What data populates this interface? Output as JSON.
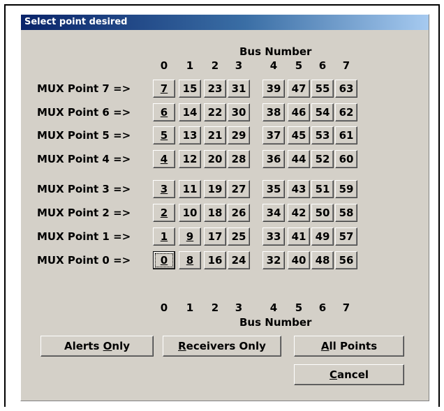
{
  "dialog": {
    "title": "Select point desired",
    "bus_number_label": "Bus Number",
    "bus_columns": [
      "0",
      "1",
      "2",
      "3",
      "4",
      "5",
      "6",
      "7"
    ],
    "rows": [
      {
        "label": "MUX Point 7 =>",
        "points": [
          "7",
          "15",
          "23",
          "31",
          "39",
          "47",
          "55",
          "63"
        ]
      },
      {
        "label": "MUX Point 6 =>",
        "points": [
          "6",
          "14",
          "22",
          "30",
          "38",
          "46",
          "54",
          "62"
        ]
      },
      {
        "label": "MUX Point 5 =>",
        "points": [
          "5",
          "13",
          "21",
          "29",
          "37",
          "45",
          "53",
          "61"
        ]
      },
      {
        "label": "MUX Point 4 =>",
        "points": [
          "4",
          "12",
          "20",
          "28",
          "36",
          "44",
          "52",
          "60"
        ]
      },
      {
        "label": "MUX Point 3 =>",
        "points": [
          "3",
          "11",
          "19",
          "27",
          "35",
          "43",
          "51",
          "59"
        ]
      },
      {
        "label": "MUX Point 2 =>",
        "points": [
          "2",
          "10",
          "18",
          "26",
          "34",
          "42",
          "50",
          "58"
        ]
      },
      {
        "label": "MUX Point 1 =>",
        "points": [
          "1",
          "9",
          "17",
          "25",
          "33",
          "41",
          "49",
          "57"
        ]
      },
      {
        "label": "MUX Point 0 =>",
        "points": [
          "0",
          "8",
          "16",
          "24",
          "32",
          "40",
          "48",
          "56"
        ]
      }
    ],
    "selected_point": "0",
    "buttons": {
      "alerts_only": {
        "before": "Alerts ",
        "accel": "O",
        "after": "nly"
      },
      "receivers_only": {
        "before": "",
        "accel": "R",
        "after": "eceivers Only"
      },
      "all_points": {
        "before": "",
        "accel": "A",
        "after": "ll Points"
      },
      "cancel": {
        "before": "",
        "accel": "C",
        "after": "ancel"
      }
    }
  }
}
